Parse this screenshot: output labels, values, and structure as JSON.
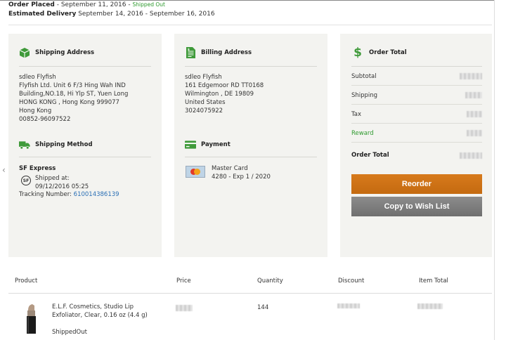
{
  "order": {
    "placed_label": "Order Placed",
    "placed_value": " - September 11, 2016 - ",
    "status": "Shipped Out",
    "delivery_label": "Estimated Delivery",
    "delivery_value": " September 14, 2016 - September 16, 2016"
  },
  "shipping_address": {
    "title": "Shipping Address",
    "lines": [
      "sdleo Flyfish",
      "Flyfish Ltd. Unit 6 F/3 Hing Wah IND",
      "Building,NO.18, Hi Ylp ST, Yuen Long",
      "HONG KONG , Hong Kong 999077",
      "Hong Kong",
      "00852-96097522"
    ]
  },
  "shipping_method": {
    "title": "Shipping Method",
    "carrier": "SF Express",
    "shipped_at_label": "Shipped at:",
    "shipped_at_value": "09/12/2016 05:25",
    "tracking_label": "Tracking Number: ",
    "tracking_number": "610014386139"
  },
  "billing_address": {
    "title": "Billing Address",
    "lines": [
      "sdleo Flyfish",
      "161 Edgemoor RD TT0168",
      "Wilmington , DE 19809",
      "United States",
      "3024075922"
    ]
  },
  "payment": {
    "title": "Payment",
    "card_type": "Master Card",
    "card_info": "4280 - Exp 1 / 2020"
  },
  "order_total": {
    "title": "Order Total",
    "rows": [
      {
        "label": "Subtotal"
      },
      {
        "label": "Shipping"
      },
      {
        "label": "Tax"
      },
      {
        "label": "Reward"
      },
      {
        "label": "Order Total"
      }
    ],
    "reorder_label": "Reorder",
    "wishlist_label": "Copy to Wish List"
  },
  "table": {
    "headers": [
      "Product",
      "Price",
      "Quantity",
      "Discount",
      "Item Total"
    ],
    "item": {
      "name": "E.L.F. Cosmetics, Studio Lip Exfoliator, Clear, 0.16 oz (4.4 g)",
      "status": "ShippedOut",
      "quantity": "144"
    }
  },
  "colors": {
    "accent_green": "#2e9a2e",
    "reorder_orange": "#c96e14",
    "link_blue": "#2a6fb5"
  }
}
